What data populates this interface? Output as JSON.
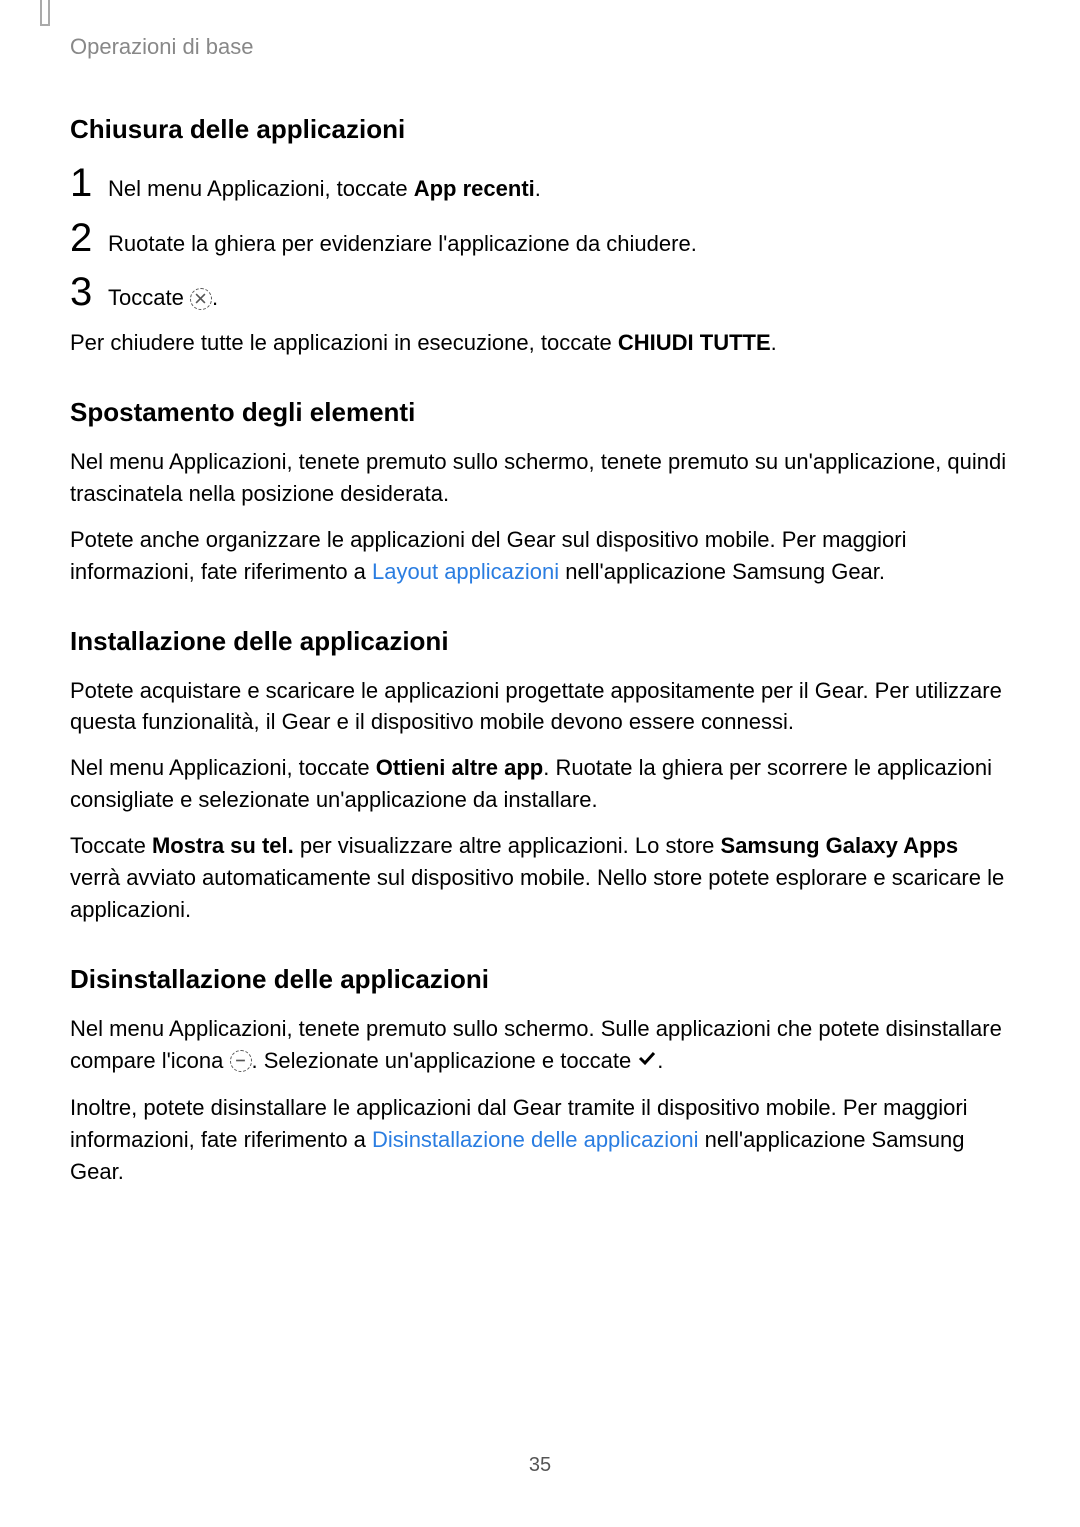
{
  "breadcrumb": "Operazioni di base",
  "h1": "Chiusura delle applicazioni",
  "step1_a": "Nel menu Applicazioni, toccate ",
  "step1_b": "App recenti",
  "step1_c": ".",
  "step2": "Ruotate la ghiera per evidenziare l'applicazione da chiudere.",
  "step3_a": "Toccate ",
  "step3_b": ".",
  "close_all_a": "Per chiudere tutte le applicazioni in esecuzione, toccate ",
  "close_all_b": "CHIUDI TUTTE",
  "close_all_c": ".",
  "h2": "Spostamento degli elementi",
  "p2": "Nel menu Applicazioni, tenete premuto sullo schermo, tenete premuto su un'applicazione, quindi trascinatela nella posizione desiderata.",
  "p3_a": "Potete anche organizzare le applicazioni del Gear sul dispositivo mobile. Per maggiori informazioni, fate riferimento a ",
  "p3_link": "Layout applicazioni",
  "p3_b": " nell'applicazione Samsung Gear.",
  "h3": "Installazione delle applicazioni",
  "p4": "Potete acquistare e scaricare le applicazioni progettate appositamente per il Gear. Per utilizzare questa funzionalità, il Gear e il dispositivo mobile devono essere connessi.",
  "p5_a": "Nel menu Applicazioni, toccate ",
  "p5_b": "Ottieni altre app",
  "p5_c": ". Ruotate la ghiera per scorrere le applicazioni consigliate e selezionate un'applicazione da installare.",
  "p6_a": "Toccate ",
  "p6_b": "Mostra su tel.",
  "p6_c": " per visualizzare altre applicazioni. Lo store ",
  "p6_d": "Samsung Galaxy Apps",
  "p6_e": " verrà avviato automaticamente sul dispositivo mobile. Nello store potete esplorare e scaricare le applicazioni.",
  "h4": "Disinstallazione delle applicazioni",
  "p7_a": "Nel menu Applicazioni, tenete premuto sullo schermo. Sulle applicazioni che potete disinstallare compare l'icona ",
  "p7_b": ". Selezionate un'applicazione e toccate ",
  "p7_c": ".",
  "p8_a": "Inoltre, potete disinstallare le applicazioni dal Gear tramite il dispositivo mobile. Per maggiori informazioni, fate riferimento a ",
  "p8_link": "Disinstallazione delle applicazioni",
  "p8_b": " nell'applicazione Samsung Gear.",
  "page_number": "35",
  "nums": {
    "one": "1",
    "two": "2",
    "three": "3"
  }
}
